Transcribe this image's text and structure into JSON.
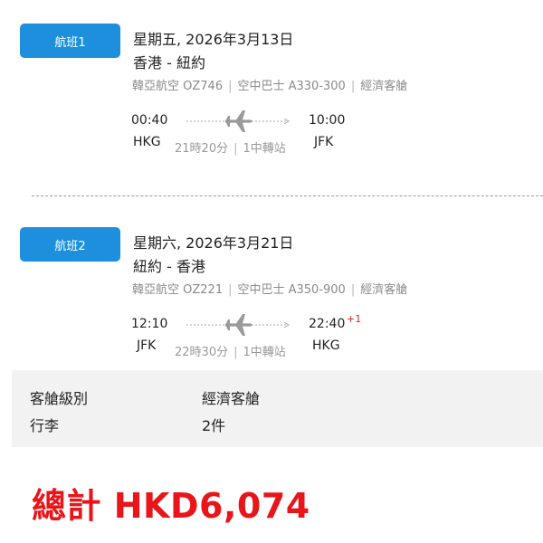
{
  "flights": [
    {
      "badge": "航班1",
      "date": "星期五, 2026年3月13日",
      "route": "香港 - 紐約",
      "airline": "韓亞航空 OZ746",
      "aircraft": "空中巴士 A330-300",
      "cabin": "經濟客艙",
      "depart_time": "00:40",
      "depart_code": "HKG",
      "arrive_time": "10:00",
      "arrive_code": "JFK",
      "duration": "21時20分",
      "stops": "1中轉站",
      "day_offset": ""
    },
    {
      "badge": "航班2",
      "date": "星期六, 2026年3月21日",
      "route": "紐約 - 香港",
      "airline": "韓亞航空 OZ221",
      "aircraft": "空中巴士 A350-900",
      "cabin": "經濟客艙",
      "depart_time": "12:10",
      "depart_code": "JFK",
      "arrive_time": "22:40",
      "arrive_code": "HKG",
      "duration": "22時30分",
      "stops": "1中轉站",
      "day_offset": "+1"
    }
  ],
  "separator": "|",
  "summary": {
    "cabin_label": "客艙級別",
    "cabin_value": "經濟客艙",
    "baggage_label": "行李",
    "baggage_value": "2件"
  },
  "total": "總計 HKD6,074",
  "colors": {
    "badge": "#1e8fdc",
    "total": "#e8151b",
    "plane": "#9a9a9a"
  },
  "icons": [
    "plane-icon",
    "arrow-right-icon"
  ]
}
